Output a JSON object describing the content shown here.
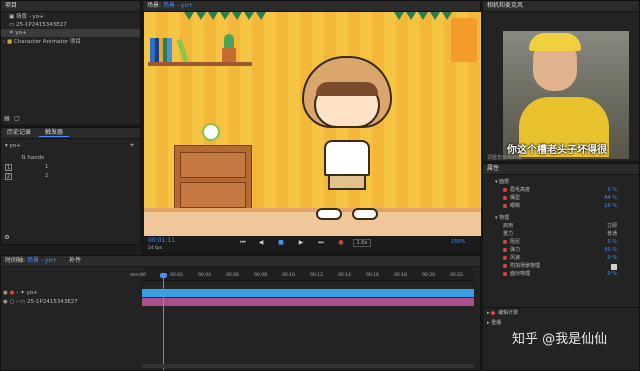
{
  "project_panel": {
    "title": "项目",
    "items": [
      "场景 - yo+",
      "25-1P2415343E27",
      "yo+",
      "Character Animator 项目"
    ]
  },
  "triggers_panel": {
    "tabs": [
      "历史记录",
      "触发器"
    ],
    "puppet_name": "yo+",
    "group_name": "hands",
    "keys": [
      "1",
      "2"
    ],
    "trigger_values": [
      "1",
      "2"
    ]
  },
  "scene_panel": {
    "title_prefix": "场景: ",
    "title_highlight": "场景 - yo+",
    "timecode": "00:01:11",
    "fps": "24 fps",
    "zoom": "1.0x",
    "zoom_percent": "150%"
  },
  "camera_panel": {
    "title": "相机和麦克风",
    "subtitle": "你这个槽老头子坏得很",
    "footer_text": "调整角色的外观"
  },
  "properties_panel": {
    "title": "属性",
    "section_a": "面部",
    "rows_a": [
      {
        "label": "眉毛高度",
        "value": "0 %"
      },
      {
        "label": "嘴型",
        "value": "44 %"
      },
      {
        "label": "眼睛",
        "value": "26 %"
      }
    ],
    "section_b": "物理",
    "rows_b": [
      {
        "label": "启用",
        "value": "立即"
      },
      {
        "label": "重力",
        "value": "普通"
      },
      {
        "label": "阻尼",
        "value": "0 %"
      },
      {
        "label": "弹力",
        "value": "30 %"
      },
      {
        "label": "风速",
        "value": "0 %"
      },
      {
        "label": "附加场景物理",
        "value": ""
      },
      {
        "label": "面对物理",
        "value": "0 %"
      }
    ],
    "footer_items": [
      "编辑计数",
      "重播"
    ]
  },
  "timeline_panel": {
    "tab_label": "时间轴: ",
    "tab_highlight": "场景 - yo+",
    "tab_extra": "补件",
    "ruler_labels": [
      "mm:00",
      "00:02",
      "00:04",
      "00:06",
      "00:08",
      "00:10",
      "00:12",
      "00:14",
      "00:16",
      "00:18",
      "00:20",
      "00:22"
    ],
    "tracks": [
      {
        "name": "yo+",
        "color": "#3aa0e6"
      },
      {
        "name": "25-1P2415343E27",
        "color": "#a94f8a"
      }
    ]
  },
  "watermark": {
    "text": "知乎 @我是仙仙"
  }
}
